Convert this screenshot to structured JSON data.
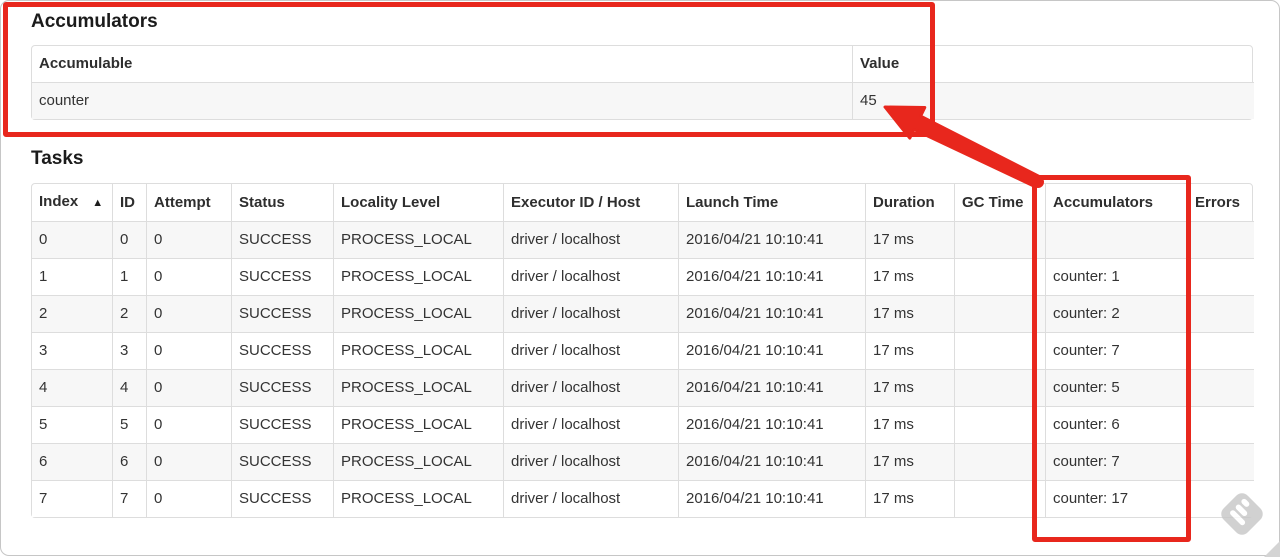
{
  "accumulators_section": {
    "title": "Accumulators",
    "table": {
      "headers": {
        "accumulable": "Accumulable",
        "value": "Value"
      },
      "rows": [
        {
          "accumulable": "counter",
          "value": "45"
        }
      ]
    }
  },
  "tasks_section": {
    "title": "Tasks",
    "table": {
      "headers": {
        "index": "Index",
        "sort_indicator": "▲",
        "id": "ID",
        "attempt": "Attempt",
        "status": "Status",
        "locality_level": "Locality Level",
        "executor_id_host": "Executor ID / Host",
        "launch_time": "Launch Time",
        "duration": "Duration",
        "gc_time": "GC Time",
        "accumulators": "Accumulators",
        "errors": "Errors"
      },
      "rows": [
        {
          "index": "0",
          "id": "0",
          "attempt": "0",
          "status": "SUCCESS",
          "locality_level": "PROCESS_LOCAL",
          "executor_id_host": "driver / localhost",
          "launch_time": "2016/04/21 10:10:41",
          "duration": "17 ms",
          "gc_time": "",
          "accumulators": "",
          "errors": ""
        },
        {
          "index": "1",
          "id": "1",
          "attempt": "0",
          "status": "SUCCESS",
          "locality_level": "PROCESS_LOCAL",
          "executor_id_host": "driver / localhost",
          "launch_time": "2016/04/21 10:10:41",
          "duration": "17 ms",
          "gc_time": "",
          "accumulators": "counter: 1",
          "errors": ""
        },
        {
          "index": "2",
          "id": "2",
          "attempt": "0",
          "status": "SUCCESS",
          "locality_level": "PROCESS_LOCAL",
          "executor_id_host": "driver / localhost",
          "launch_time": "2016/04/21 10:10:41",
          "duration": "17 ms",
          "gc_time": "",
          "accumulators": "counter: 2",
          "errors": ""
        },
        {
          "index": "3",
          "id": "3",
          "attempt": "0",
          "status": "SUCCESS",
          "locality_level": "PROCESS_LOCAL",
          "executor_id_host": "driver / localhost",
          "launch_time": "2016/04/21 10:10:41",
          "duration": "17 ms",
          "gc_time": "",
          "accumulators": "counter: 7",
          "errors": ""
        },
        {
          "index": "4",
          "id": "4",
          "attempt": "0",
          "status": "SUCCESS",
          "locality_level": "PROCESS_LOCAL",
          "executor_id_host": "driver / localhost",
          "launch_time": "2016/04/21 10:10:41",
          "duration": "17 ms",
          "gc_time": "",
          "accumulators": "counter: 5",
          "errors": ""
        },
        {
          "index": "5",
          "id": "5",
          "attempt": "0",
          "status": "SUCCESS",
          "locality_level": "PROCESS_LOCAL",
          "executor_id_host": "driver / localhost",
          "launch_time": "2016/04/21 10:10:41",
          "duration": "17 ms",
          "gc_time": "",
          "accumulators": "counter: 6",
          "errors": ""
        },
        {
          "index": "6",
          "id": "6",
          "attempt": "0",
          "status": "SUCCESS",
          "locality_level": "PROCESS_LOCAL",
          "executor_id_host": "driver / localhost",
          "launch_time": "2016/04/21 10:10:41",
          "duration": "17 ms",
          "gc_time": "",
          "accumulators": "counter: 7",
          "errors": ""
        },
        {
          "index": "7",
          "id": "7",
          "attempt": "0",
          "status": "SUCCESS",
          "locality_level": "PROCESS_LOCAL",
          "executor_id_host": "driver / localhost",
          "launch_time": "2016/04/21 10:10:41",
          "duration": "17 ms",
          "gc_time": "",
          "accumulators": "counter: 17",
          "errors": ""
        }
      ]
    }
  },
  "annotations": {
    "highlight_color": "#e8271d",
    "box_targets": [
      "accumulators-summary",
      "accumulators-task-column"
    ],
    "arrow_points_to": "45",
    "watermark_icon": "skitch-stamp-icon"
  }
}
